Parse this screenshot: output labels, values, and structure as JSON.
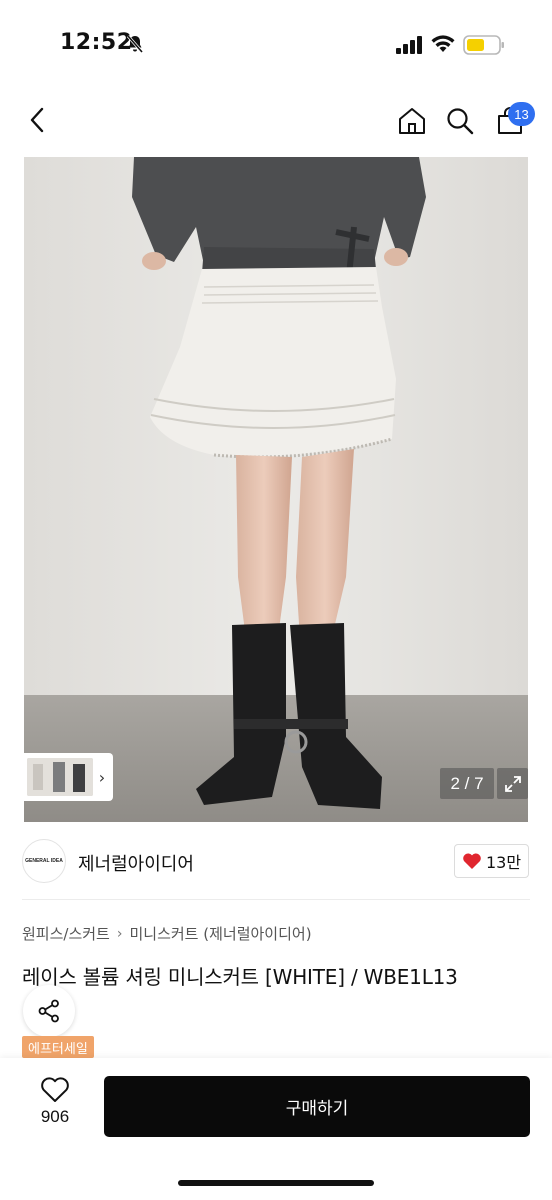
{
  "status_bar": {
    "time": "12:52",
    "icons": [
      "bell-slash-icon",
      "signal-icon",
      "wifi-icon",
      "battery-icon"
    ],
    "battery_color": "#f5d000"
  },
  "nav": {
    "icons": [
      "chevron-left-icon",
      "home-icon",
      "search-icon",
      "shopping-bag-icon"
    ],
    "cart_count": "13",
    "badge_color": "#2f6ff0"
  },
  "gallery": {
    "page": "2 / 7",
    "thumbnail_icon": "chevron-right-icon",
    "expand_icon": "expand-icon"
  },
  "brand": {
    "logo_text": "GENERAL IDEA",
    "name": "제너럴아이디어",
    "likes": "13만",
    "heart_color": "#e0262f"
  },
  "product": {
    "breadcrumb": [
      "원피스/스커트",
      "미니스커트 (제너럴아이디어)"
    ],
    "title": "레이스 볼륨 셔링 미니스커트 [WHITE] / WBE1L13",
    "sale_badge": "에프터세일",
    "sale_color": "#f0a46a"
  },
  "bottom_bar": {
    "wish_count": "906",
    "buy_label": "구매하기"
  }
}
